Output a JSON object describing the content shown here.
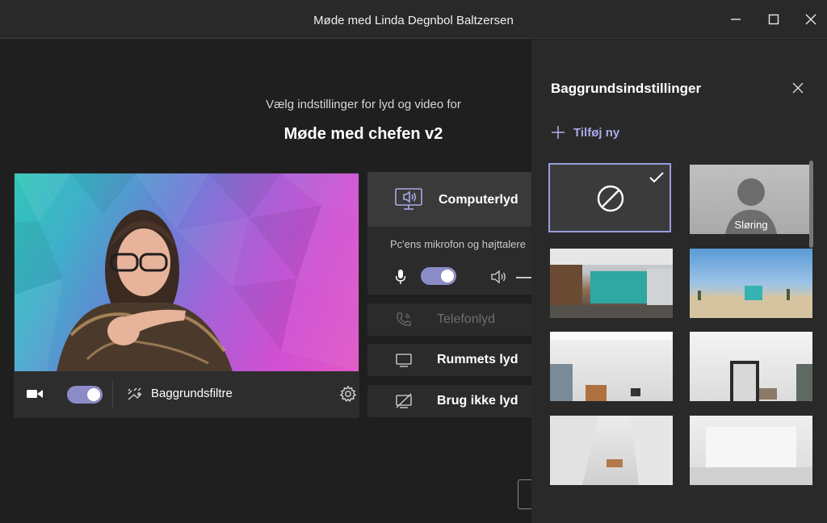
{
  "window": {
    "title": "Møde med Linda Degnbol Baltzersen",
    "controls": [
      "minimize",
      "maximize",
      "close"
    ]
  },
  "setup": {
    "subtitle": "Vælg indstillinger for lyd og video for",
    "meeting_title": "Møde med chefen v2"
  },
  "video": {
    "camera_on": true,
    "background_filters_label": "Baggrundsfiltre"
  },
  "audio": {
    "computer_audio_label": "Computerlyd",
    "computer_audio_sub": "Pc'ens mikrofon og højttalere",
    "mic_on": true,
    "options": [
      {
        "label": "Telefonlyd",
        "disabled": true,
        "icon": "phone-icon"
      },
      {
        "label": "Rummets lyd",
        "disabled": false,
        "icon": "room-screen-icon"
      },
      {
        "label": "Brug ikke lyd",
        "disabled": false,
        "icon": "no-audio-icon"
      }
    ]
  },
  "background_panel": {
    "title": "Baggrundsindstillinger",
    "add_new_label": "Tilføj ny",
    "items": [
      {
        "kind": "none",
        "label": "",
        "selected": true
      },
      {
        "kind": "blur",
        "label": "Sløring",
        "selected": false
      },
      {
        "kind": "office",
        "label": "",
        "selected": false
      },
      {
        "kind": "beach",
        "label": "",
        "selected": false
      },
      {
        "kind": "room-white-1",
        "label": "",
        "selected": false
      },
      {
        "kind": "room-white-2",
        "label": "",
        "selected": false
      },
      {
        "kind": "room-white-3",
        "label": "",
        "selected": false
      },
      {
        "kind": "room-white-4",
        "label": "",
        "selected": false
      }
    ]
  },
  "colors": {
    "accent": "#8b8cc7",
    "accent_text": "#a9a9e8",
    "background": "#1f1f1f",
    "panel": "#292929"
  }
}
